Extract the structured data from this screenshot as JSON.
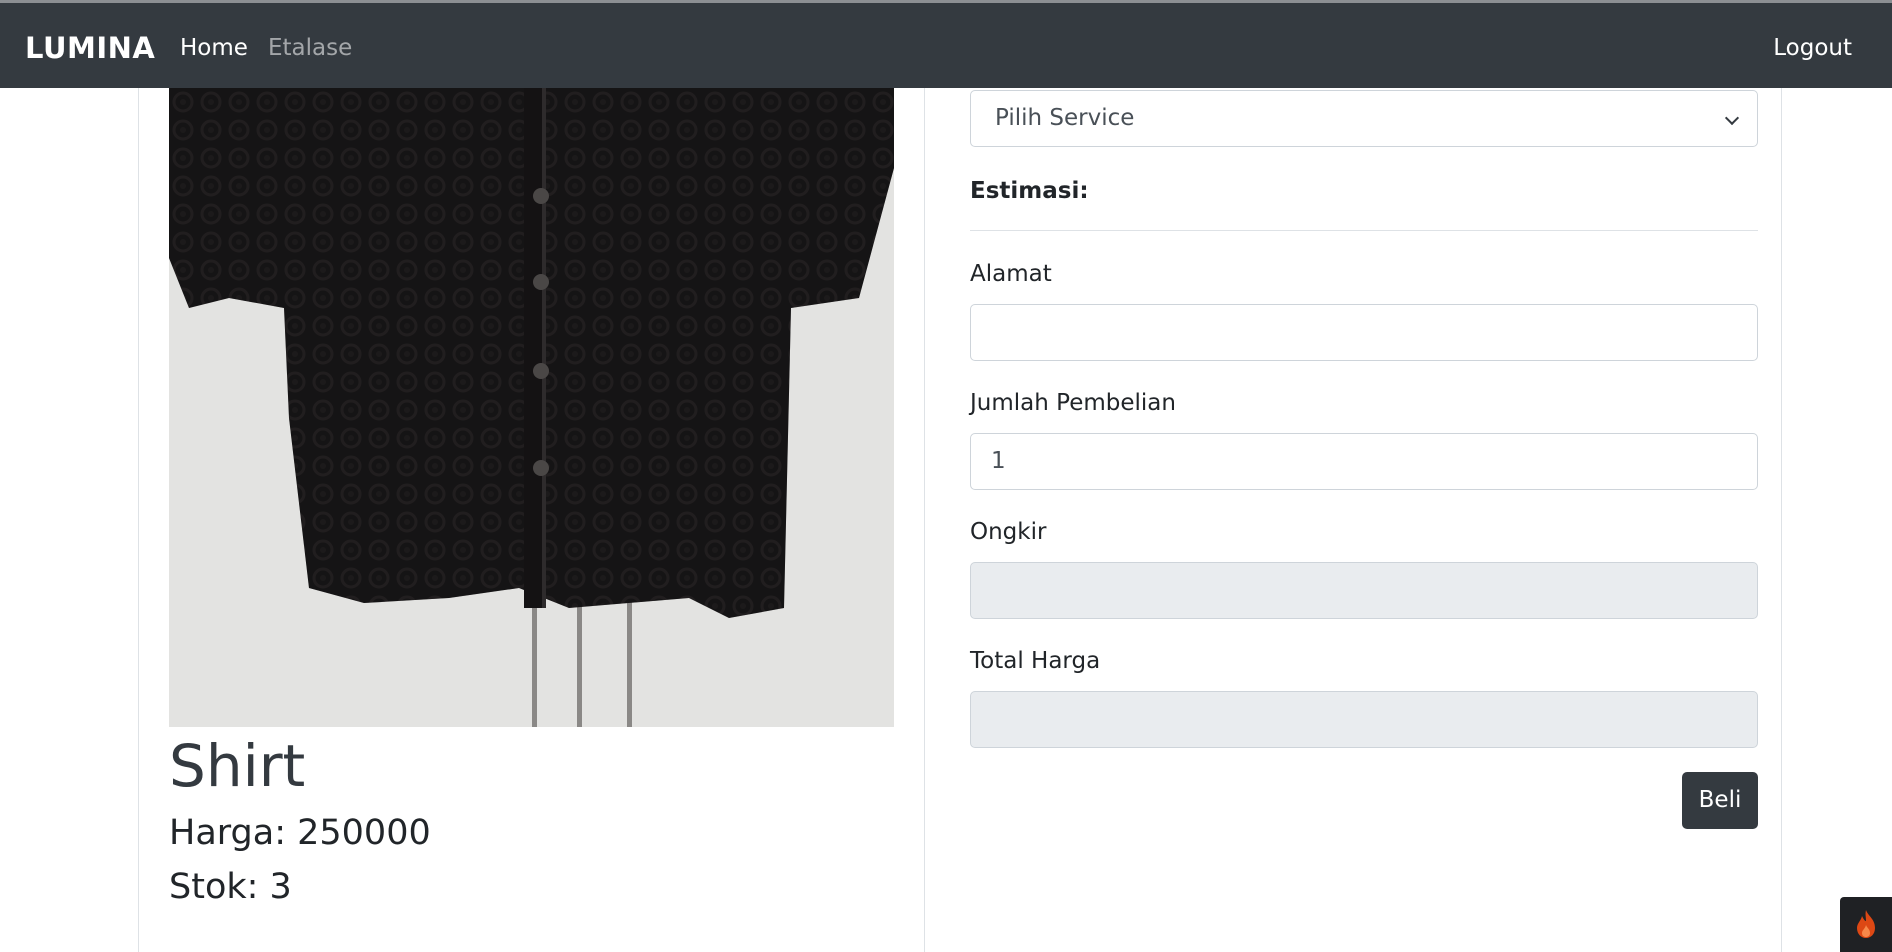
{
  "navbar": {
    "brand": "LUMINA",
    "links": [
      {
        "label": "Home"
      },
      {
        "label": "Etalase"
      }
    ],
    "logout": "Logout"
  },
  "product": {
    "image_alt": "crochet shirt",
    "title": "Shirt",
    "price_text": "Harga: 250000",
    "stock_text": "Stok: 3"
  },
  "form": {
    "service_select": {
      "selected": "Pilih Service"
    },
    "estimasi_label": "Estimasi:",
    "alamat": {
      "label": "Alamat",
      "value": ""
    },
    "jumlah": {
      "label": "Jumlah Pembelian",
      "value": "1"
    },
    "ongkir": {
      "label": "Ongkir",
      "value": ""
    },
    "total": {
      "label": "Total Harga",
      "value": ""
    },
    "buy_label": "Beli"
  },
  "colors": {
    "navbar_bg": "#343a40",
    "button_bg": "#343a40",
    "readonly_bg": "#e9ecef"
  },
  "icons": [
    "chevron-down-icon",
    "flame-icon"
  ]
}
